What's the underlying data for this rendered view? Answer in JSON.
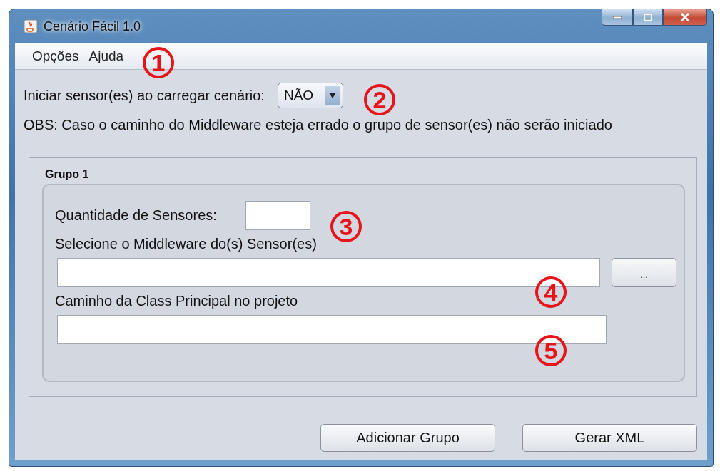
{
  "window": {
    "title": "Cenário Fácil 1.0"
  },
  "menu": [
    "Opções",
    "Ajuda"
  ],
  "start_option": {
    "label": "Iniciar sensor(es) ao carregar cenário:",
    "value": "NÃO"
  },
  "note": "OBS: Caso o caminho do Middleware esteja errado o grupo de sensor(es) não serão iniciado",
  "group": {
    "title": "Grupo 1",
    "quantity_label": "Quantidade de Sensores:",
    "middleware_label": "Selecione o Middleware do(s) Sensor(es)",
    "browse_button": "...",
    "class_label": "Caminho da Class Principal no projeto"
  },
  "buttons": [
    "Adicionar Grupo",
    "Gerar XML"
  ],
  "annotations": [
    "1",
    "2",
    "3",
    "4",
    "5"
  ]
}
